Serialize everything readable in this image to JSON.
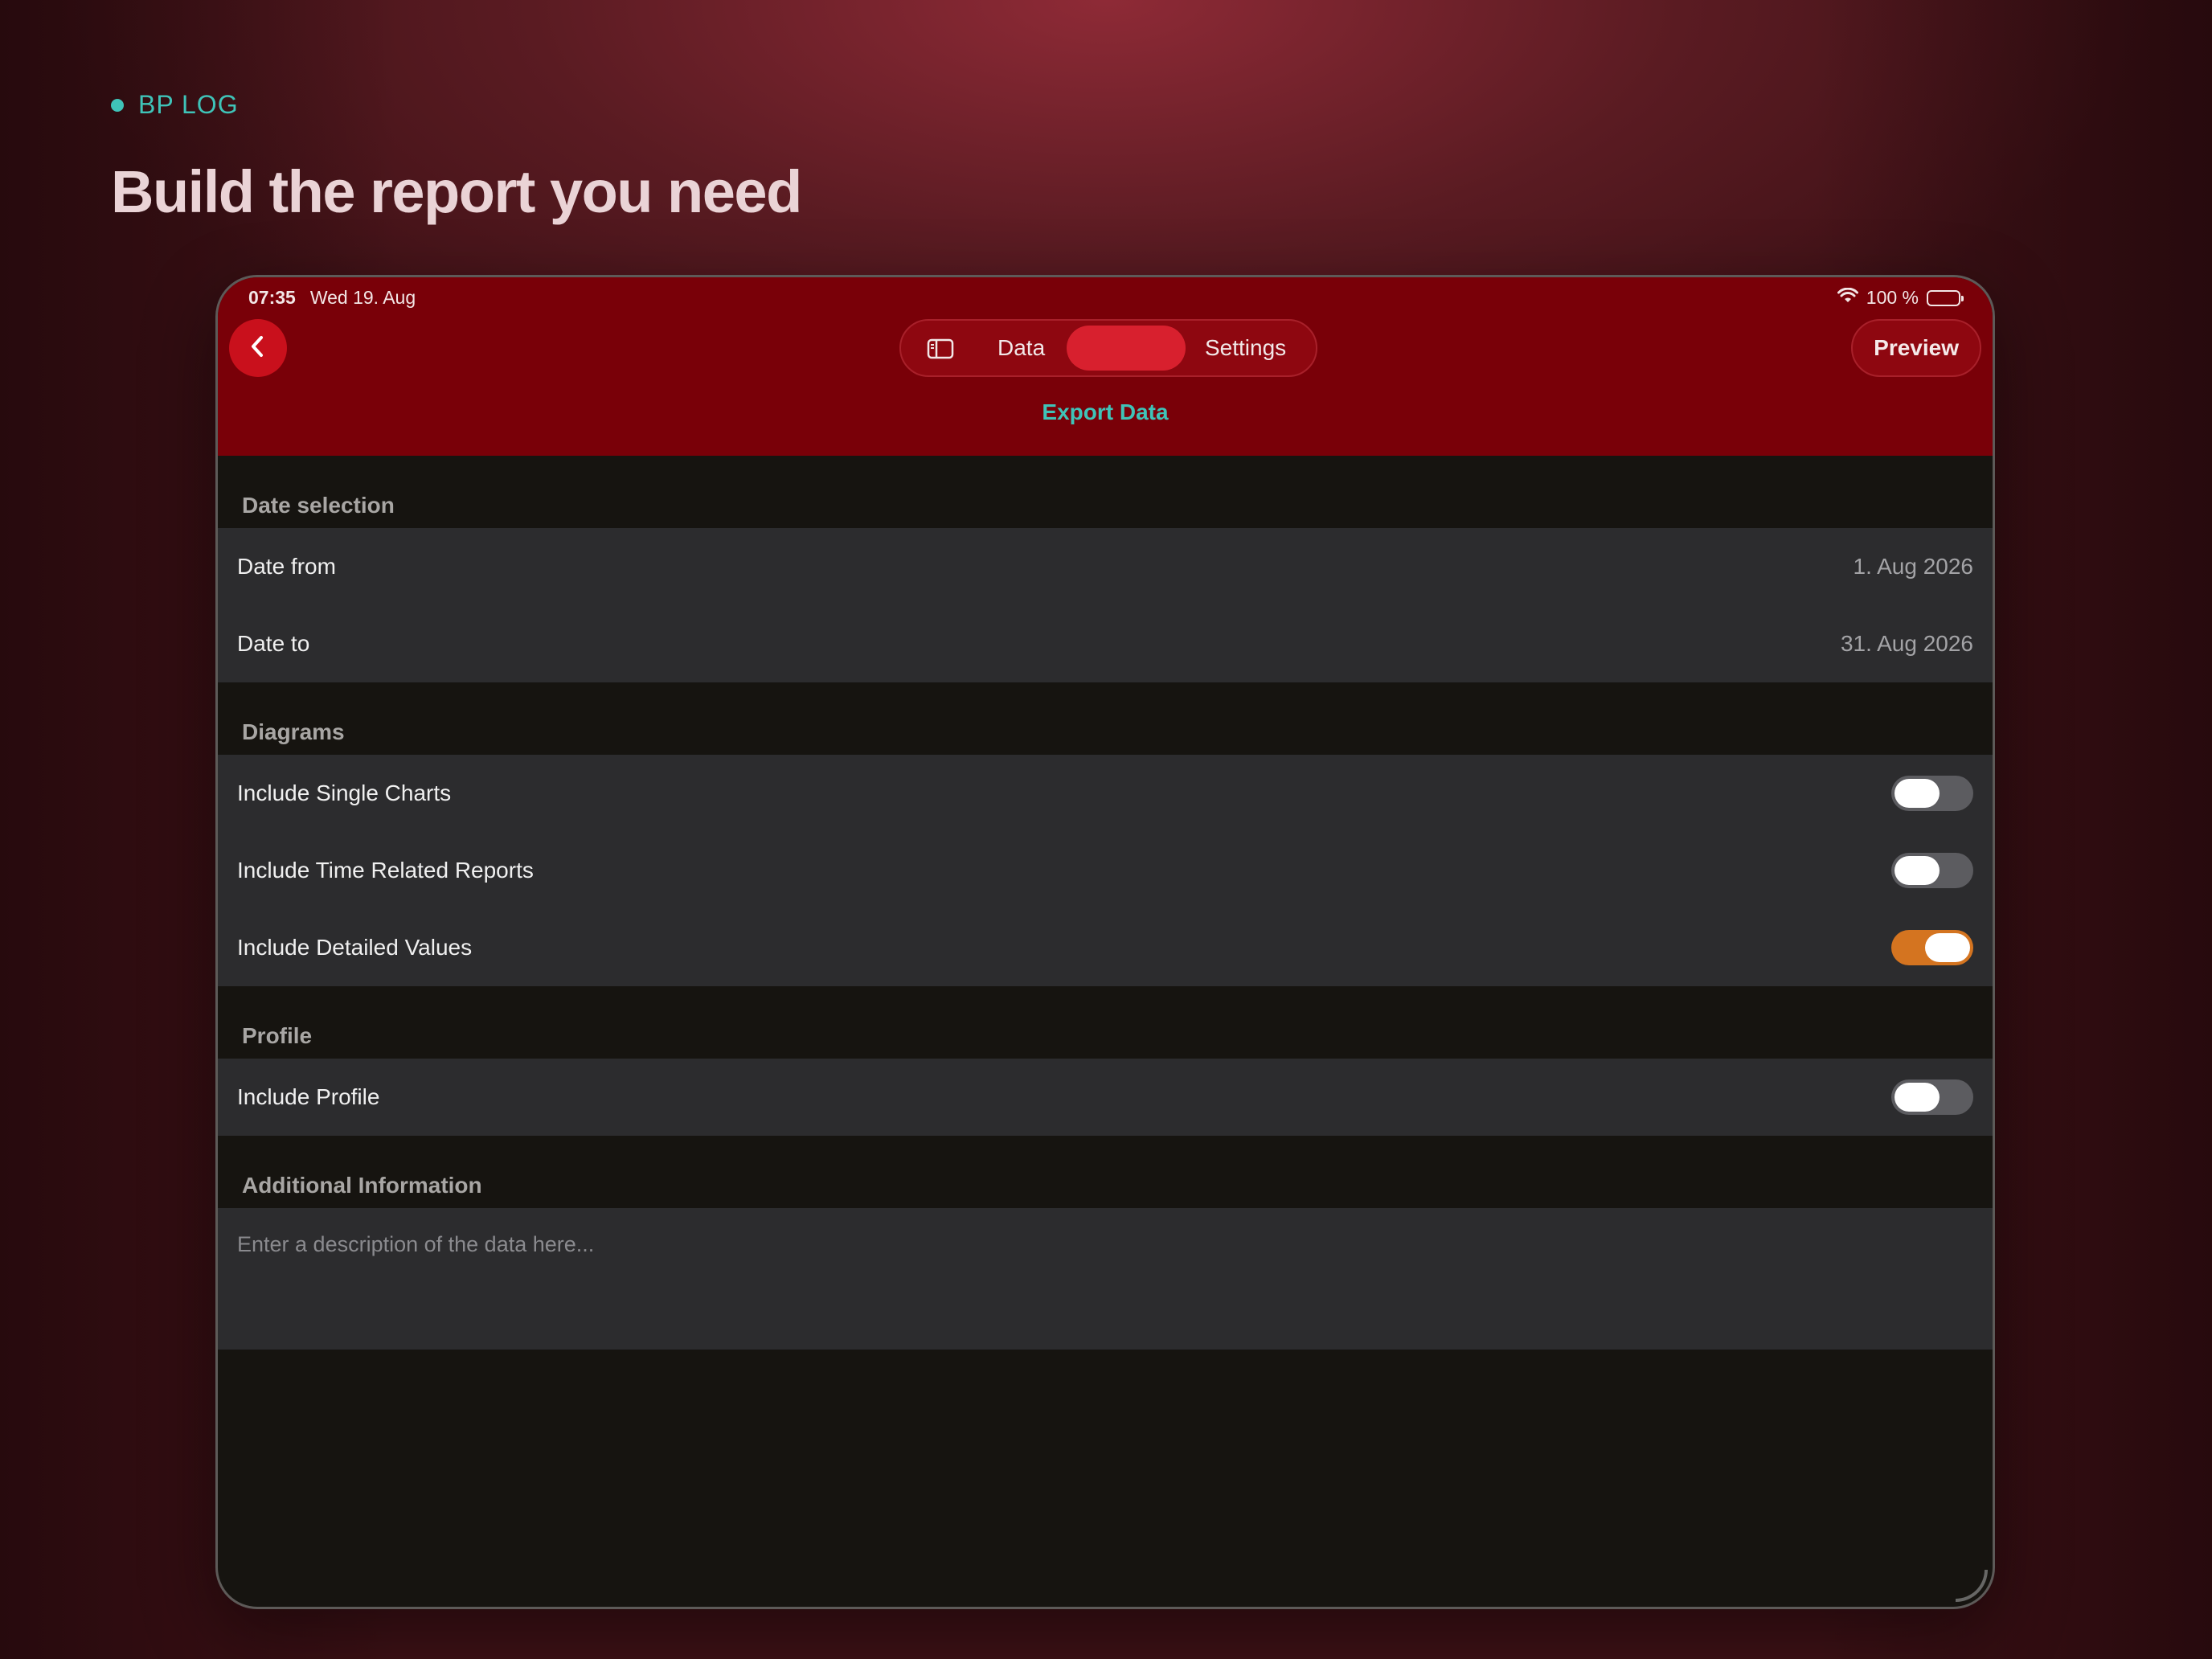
{
  "promo": {
    "eyebrow": "BP LOG",
    "headline": "Build the report you need"
  },
  "status_bar": {
    "time": "07:35",
    "date": "Wed 19. Aug",
    "battery": "100 %",
    "battery_level": 100
  },
  "nav": {
    "back_icon": "chevron-left-icon",
    "sidebar_icon": "sidebar-icon",
    "segments": [
      {
        "label": "Data"
      },
      {
        "label": ""
      },
      {
        "label": "Settings"
      }
    ],
    "active_segment": 1,
    "preview_label": "Preview",
    "title": "Export Data"
  },
  "sections": {
    "date_selection": {
      "header": "Date selection",
      "rows": [
        {
          "label": "Date from",
          "value": "1. Aug 2026"
        },
        {
          "label": "Date to",
          "value": "31. Aug 2026"
        }
      ]
    },
    "diagrams": {
      "header": "Diagrams",
      "rows": [
        {
          "label": "Include Single Charts",
          "on": false
        },
        {
          "label": "Include Time Related Reports",
          "on": false
        },
        {
          "label": "Include Detailed Values",
          "on": true
        }
      ]
    },
    "profile": {
      "header": "Profile",
      "rows": [
        {
          "label": "Include Profile",
          "on": false
        }
      ]
    },
    "additional": {
      "header": "Additional Information",
      "placeholder": "Enter a description of the data here..."
    }
  },
  "colors": {
    "accent_teal": "#3fc3b8",
    "topbar_red": "#790008",
    "toggle_on": "#d47420",
    "toggle_off": "#5c5c60"
  }
}
